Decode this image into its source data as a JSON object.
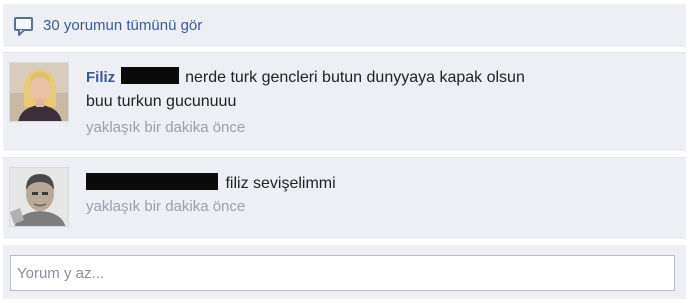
{
  "view_all": {
    "icon": "comment-bubble-icon",
    "label": "30 yorumun tümünü gör"
  },
  "comments": [
    {
      "author": "Filiz",
      "author_name_redacted": true,
      "text_line1": "nerde turk gencleri butun dunyyaya kapak olsun",
      "text_line2": "buu turkun gucunuuu",
      "time": "yaklaşık bir dakika önce"
    },
    {
      "author_name_redacted": true,
      "text_line1": "filiz sevişelimmi",
      "time": "yaklaşık bir dakika önce"
    }
  ],
  "reply": {
    "placeholder": "Yorum y az..."
  },
  "colors": {
    "link": "#3b5998",
    "panel_bg": "#edeff4",
    "muted_text": "#9a9fae"
  }
}
